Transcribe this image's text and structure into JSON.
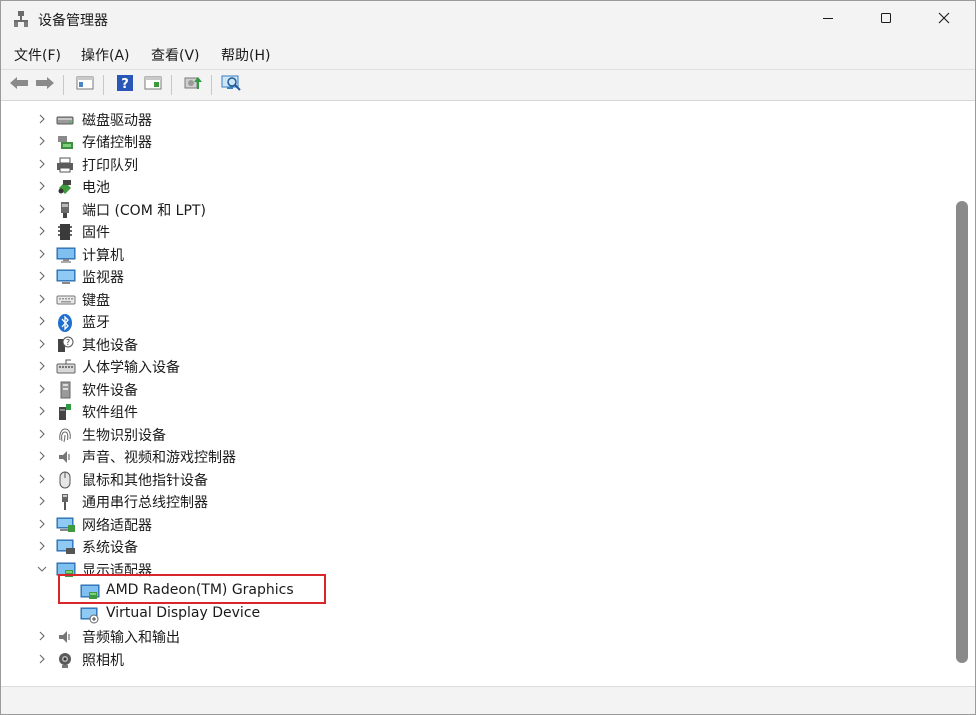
{
  "window": {
    "title": "设备管理器",
    "icons": {
      "app": "device-manager-icon",
      "minimize": "minimize-icon",
      "maximize": "maximize-icon",
      "close": "close-icon"
    }
  },
  "menu": {
    "items": [
      {
        "label": "文件(F)"
      },
      {
        "label": "操作(A)"
      },
      {
        "label": "查看(V)"
      },
      {
        "label": "帮助(H)"
      }
    ]
  },
  "toolbar": {
    "buttons": [
      {
        "icon": "back-arrow-icon"
      },
      {
        "icon": "forward-arrow-icon"
      },
      {
        "icon": "show-hide-console-tree-icon"
      },
      {
        "icon": "help-icon"
      },
      {
        "icon": "properties-icon"
      },
      {
        "icon": "update-driver-icon"
      },
      {
        "icon": "scan-hardware-icon"
      }
    ]
  },
  "tree": {
    "nodes": [
      {
        "label": "磁盘驱动器",
        "icon": "disk-drive-icon",
        "expanded": false,
        "level": 0
      },
      {
        "label": "存储控制器",
        "icon": "storage-controller-icon",
        "expanded": false,
        "level": 0
      },
      {
        "label": "打印队列",
        "icon": "printer-icon",
        "expanded": false,
        "level": 0
      },
      {
        "label": "电池",
        "icon": "battery-icon",
        "expanded": false,
        "level": 0
      },
      {
        "label": "端口 (COM 和 LPT)",
        "icon": "port-icon",
        "expanded": false,
        "level": 0
      },
      {
        "label": "固件",
        "icon": "firmware-icon",
        "expanded": false,
        "level": 0
      },
      {
        "label": "计算机",
        "icon": "computer-icon",
        "expanded": false,
        "level": 0
      },
      {
        "label": "监视器",
        "icon": "monitor-icon",
        "expanded": false,
        "level": 0
      },
      {
        "label": "键盘",
        "icon": "keyboard-icon",
        "expanded": false,
        "level": 0
      },
      {
        "label": "蓝牙",
        "icon": "bluetooth-icon",
        "expanded": false,
        "level": 0
      },
      {
        "label": "其他设备",
        "icon": "other-device-icon",
        "expanded": false,
        "level": 0
      },
      {
        "label": "人体学输入设备",
        "icon": "hid-icon",
        "expanded": false,
        "level": 0
      },
      {
        "label": "软件设备",
        "icon": "software-device-icon",
        "expanded": false,
        "level": 0
      },
      {
        "label": "软件组件",
        "icon": "software-component-icon",
        "expanded": false,
        "level": 0
      },
      {
        "label": "生物识别设备",
        "icon": "fingerprint-icon",
        "expanded": false,
        "level": 0
      },
      {
        "label": "声音、视频和游戏控制器",
        "icon": "speaker-icon",
        "expanded": false,
        "level": 0
      },
      {
        "label": "鼠标和其他指针设备",
        "icon": "mouse-icon",
        "expanded": false,
        "level": 0
      },
      {
        "label": "通用串行总线控制器",
        "icon": "usb-icon",
        "expanded": false,
        "level": 0
      },
      {
        "label": "网络适配器",
        "icon": "network-adapter-icon",
        "expanded": false,
        "level": 0
      },
      {
        "label": "系统设备",
        "icon": "system-device-icon",
        "expanded": false,
        "level": 0
      },
      {
        "label": "显示适配器",
        "icon": "display-adapter-icon",
        "expanded": true,
        "level": 0
      },
      {
        "label": "AMD Radeon(TM) Graphics",
        "icon": "display-adapter-icon",
        "expanded": null,
        "level": 1,
        "highlighted": true
      },
      {
        "label": "Virtual Display Device",
        "icon": "virtual-display-icon",
        "expanded": null,
        "level": 1
      },
      {
        "label": "音频输入和输出",
        "icon": "audio-io-icon",
        "expanded": false,
        "level": 0
      },
      {
        "label": "照相机",
        "icon": "camera-icon",
        "expanded": false,
        "level": 0
      }
    ]
  },
  "colors": {
    "highlight_border": "#d9262b",
    "accent_blue": "#2b7fd6"
  }
}
